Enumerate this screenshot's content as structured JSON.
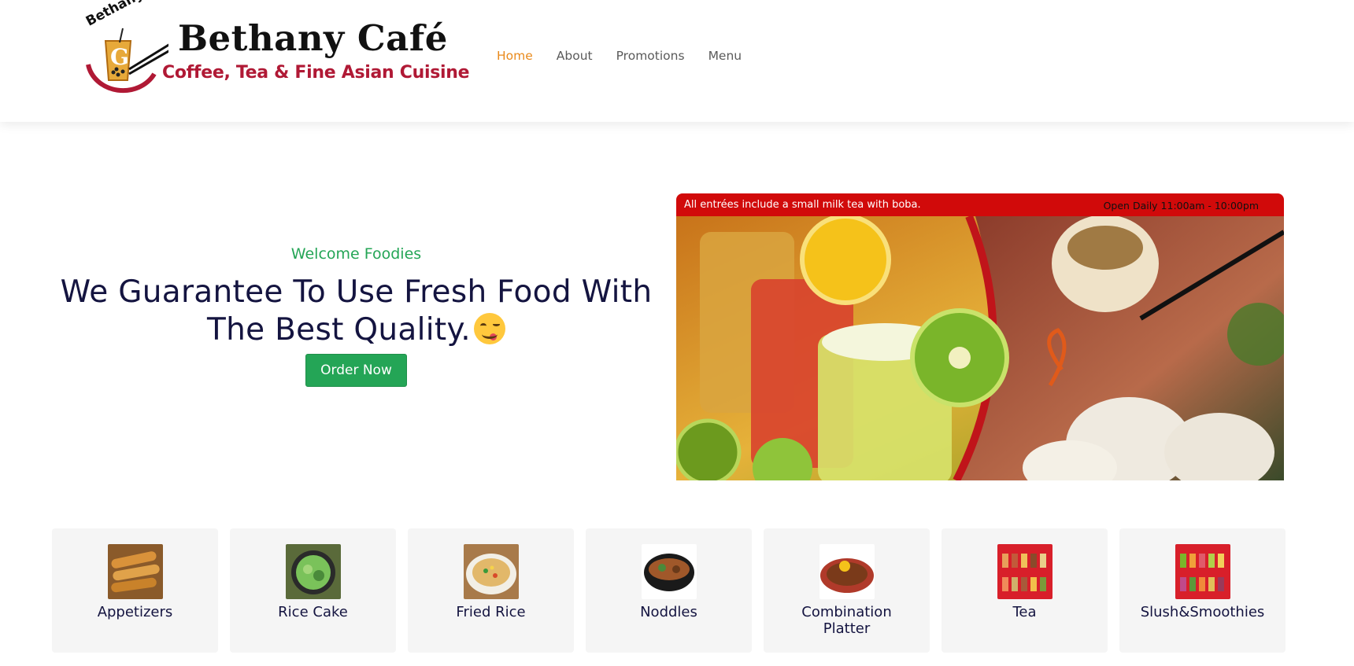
{
  "brand": {
    "arc_text": "Bethany",
    "name": "Bethany Café",
    "tagline": "Coffee, Tea & Fine Asian Cuisine"
  },
  "nav": {
    "items": [
      {
        "label": "Home",
        "active": true
      },
      {
        "label": "About",
        "active": false
      },
      {
        "label": "Promotions",
        "active": false
      },
      {
        "label": "Menu",
        "active": false
      }
    ]
  },
  "hero": {
    "welcome": "Welcome Foodies",
    "headline_line1": "We Guarantee To Use Fresh Food With",
    "headline_line2": "The Best Quality.",
    "cta": "Order Now"
  },
  "banner": {
    "left_text": "All entrées include a small milk tea with boba.",
    "right_text": "Open Daily 11:00am - 10:00pm"
  },
  "categories": [
    {
      "label": "Appetizers",
      "icon": "spring-rolls-image"
    },
    {
      "label": "Rice Cake",
      "icon": "rice-cake-image"
    },
    {
      "label": "Fried Rice",
      "icon": "fried-rice-image"
    },
    {
      "label": "Noddles",
      "icon": "noodles-image"
    },
    {
      "label": "Combination Platter",
      "icon": "platter-image"
    },
    {
      "label": "Tea",
      "icon": "tea-menu-image"
    },
    {
      "label": "Slush&Smoothies",
      "icon": "smoothie-menu-image"
    }
  ],
  "colors": {
    "accent_orange": "#e98a1c",
    "green": "#24a556",
    "brand_red": "#b01935",
    "banner_red": "#d10a0a",
    "headline": "#141440"
  }
}
